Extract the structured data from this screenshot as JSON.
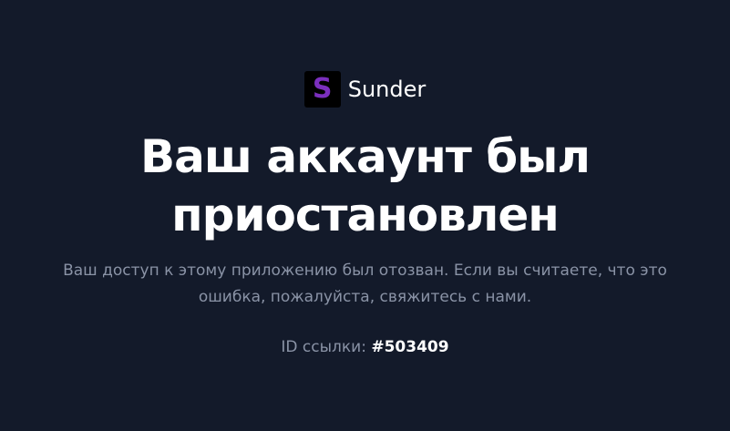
{
  "brand": {
    "logo_letter": "S",
    "name": "Sunder",
    "logo_color": "#7b2fbe"
  },
  "headline": {
    "line1": "Ваш аккаунт был",
    "line2": "приостановлен"
  },
  "message": {
    "line1": "Ваш доступ к этому приложению был отозван. Если вы считаете, что это",
    "line2": "ошибка, пожалуйста, свяжитесь с нами."
  },
  "reference": {
    "label": "ID ссылки:",
    "id": "#503409"
  },
  "colors": {
    "background": "#131a2a",
    "text_primary": "#ffffff",
    "text_muted": "#8a93a6"
  }
}
